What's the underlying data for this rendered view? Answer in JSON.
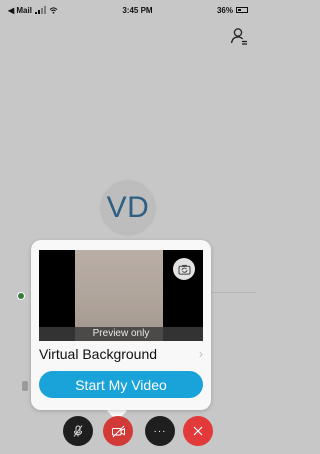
{
  "status_bar": {
    "back_label": "◀ Mail",
    "time": "3:45 PM",
    "battery_percent": "36%"
  },
  "meeting": {
    "avatar_initials": "VD"
  },
  "video_popover": {
    "preview_caption": "Preview only",
    "virtual_background_label": "Virtual Background",
    "virtual_background_chevron": "›",
    "start_video_label": "Start My Video"
  },
  "controls": {
    "more_label": "···"
  },
  "colors": {
    "background": "#c7c7c7",
    "accent": "#1aa3d9",
    "video_off": "#d23a37",
    "leave": "#e23a3a",
    "avatar_text": "#2e5f82"
  }
}
